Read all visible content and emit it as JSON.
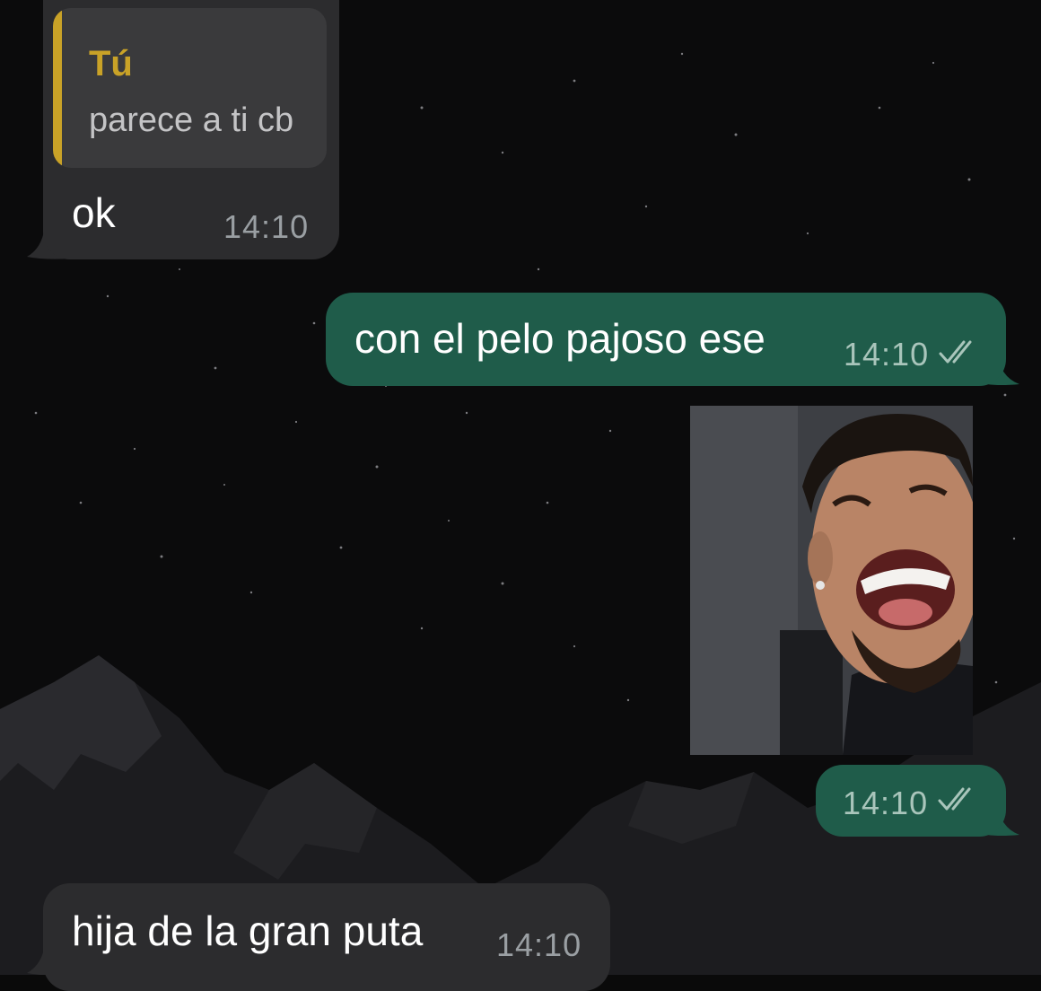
{
  "messages": [
    {
      "direction": "incoming",
      "reply_to": {
        "author": "Tú",
        "text": "parece a ti cb"
      },
      "text": "ok",
      "time": "14:10"
    },
    {
      "direction": "outgoing",
      "text": "con el pelo pajoso ese",
      "time": "14:10",
      "status": "read-double-check"
    },
    {
      "direction": "outgoing",
      "media": "photo",
      "media_description": "smiling man selfie",
      "time": "14:10",
      "status": "read-double-check"
    },
    {
      "direction": "incoming",
      "text": "hija de la gran puta",
      "time": "14:10"
    }
  ],
  "colors": {
    "incoming_bubble": "#2c2c2e",
    "outgoing_bubble": "#1f5c4a",
    "quote_accent": "#c9a227"
  }
}
